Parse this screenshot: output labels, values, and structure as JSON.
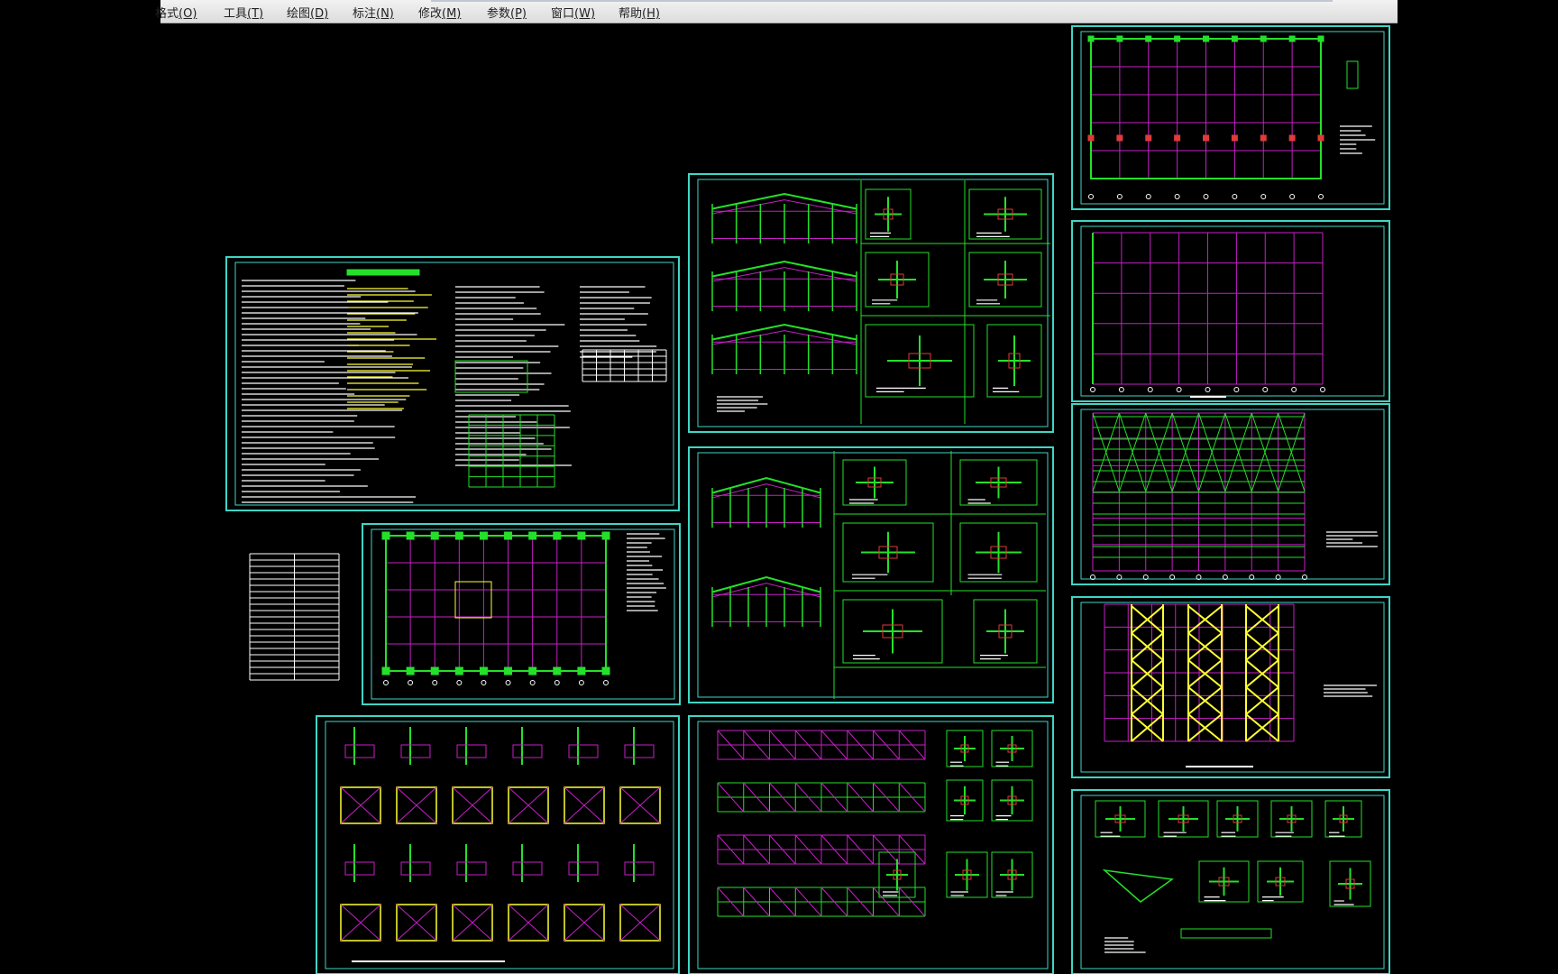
{
  "menubar": {
    "items": [
      {
        "name": "menu-format",
        "label": "格式",
        "key": "(O)"
      },
      {
        "name": "menu-tools",
        "label": "工具",
        "key": "(T)"
      },
      {
        "name": "menu-draw",
        "label": "绘图",
        "key": "(D)"
      },
      {
        "name": "menu-dimension",
        "label": "标注",
        "key": "(N)"
      },
      {
        "name": "menu-modify",
        "label": "修改",
        "key": "(M)"
      },
      {
        "name": "menu-parameters",
        "label": "参数",
        "key": "(P)"
      },
      {
        "name": "menu-window",
        "label": "窗口",
        "key": "(W)"
      },
      {
        "name": "menu-help",
        "label": "帮助",
        "key": "(H)"
      }
    ]
  },
  "drawing": {
    "background": "#000000",
    "colors": {
      "frame": "#3fd6c4",
      "grid": "#c61fc6",
      "member": "#25e02a",
      "text": "#ffffff",
      "highlight": "#ffff33",
      "detail": "#e03a3a",
      "cyan": "#35d6e6"
    }
  }
}
